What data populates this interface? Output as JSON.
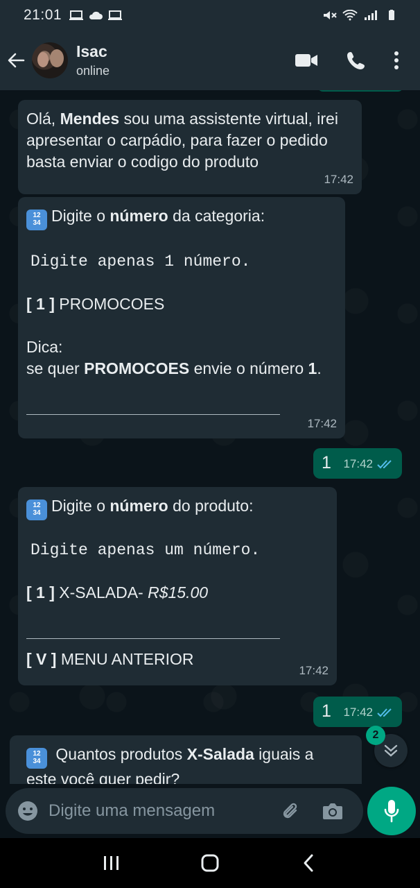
{
  "status_bar": {
    "time": "21:01"
  },
  "header": {
    "contact_name": "Isac",
    "contact_status": "online"
  },
  "messages": [
    {
      "id": "m1",
      "direction": "in",
      "time": "17:42",
      "greeting_prefix": "Olá, ",
      "greeting_name": "Mendes",
      "greeting_rest": " sou uma assistente virtual, irei apresentar o carpádio, para fazer o pedido basta enviar o codigo do produto"
    },
    {
      "id": "m2",
      "direction": "in",
      "time": "17:42",
      "line1_prefix": "Digite o ",
      "line1_bold": "número",
      "line1_suffix": " da categoria:",
      "mono_line": "Digite apenas 1 número.",
      "option_code": "[ 1 ]",
      "option_label": "PROMOCOES",
      "tip_title": "Dica:",
      "tip_prefix": "se quer ",
      "tip_bold": "PROMOCOES",
      "tip_mid": " envie o número ",
      "tip_num": "1",
      "tip_end": "."
    },
    {
      "id": "m3",
      "direction": "out",
      "text": "1",
      "time": "17:42",
      "ticks": "read"
    },
    {
      "id": "m4",
      "direction": "in",
      "time": "17:42",
      "line1_prefix": "Digite o ",
      "line1_bold": "número",
      "line1_suffix": " do produto:",
      "mono_line": "Digite apenas um número.",
      "option_code": "[ 1 ]",
      "option_label": "X-SALADA-",
      "option_price": " R$15.00",
      "back_code": "[ V ]",
      "back_label": "MENU ANTERIOR"
    },
    {
      "id": "m5",
      "direction": "out",
      "text": "1",
      "time": "17:42",
      "ticks": "read"
    },
    {
      "id": "m6",
      "direction": "in",
      "q_prefix": "Quantos produtos ",
      "q_bold": "X-Salada",
      "q_suffix": " iguais a este você quer pedir?"
    }
  ],
  "emoji_keycap": {
    "top": "12",
    "bottom": "34"
  },
  "scroll_badge": "2",
  "composer": {
    "placeholder": "Digite uma mensagem"
  },
  "colors": {
    "accent": "#00a884",
    "bubble_in": "#1f2c34",
    "bubble_out": "#005c4b",
    "tick_read": "#53bdeb"
  }
}
